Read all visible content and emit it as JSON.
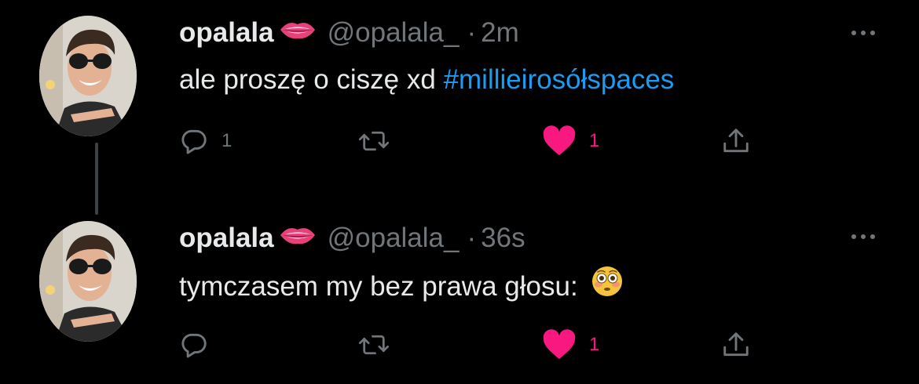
{
  "tweets": [
    {
      "display_name": "opalala",
      "name_emoji": "lips",
      "handle": "@opalala_",
      "separator": "·",
      "time": "2m",
      "text": "ale proszę o ciszę xd",
      "hashtag": "#millieirosółspaces",
      "reply_count": "1",
      "retweet_count": "",
      "like_count": "1",
      "liked": true
    },
    {
      "display_name": "opalala",
      "name_emoji": "lips",
      "handle": "@opalala_",
      "separator": "·",
      "time": "36s",
      "text": "tymczasem my bez prawa głosu:",
      "text_emoji": "flushed-face",
      "reply_count": "",
      "retweet_count": "",
      "like_count": "1",
      "liked": true
    }
  ],
  "colors": {
    "background": "#000000",
    "text": "#e7e9ea",
    "secondary": "#71767b",
    "link": "#1d9bf0",
    "like": "#f91880"
  }
}
